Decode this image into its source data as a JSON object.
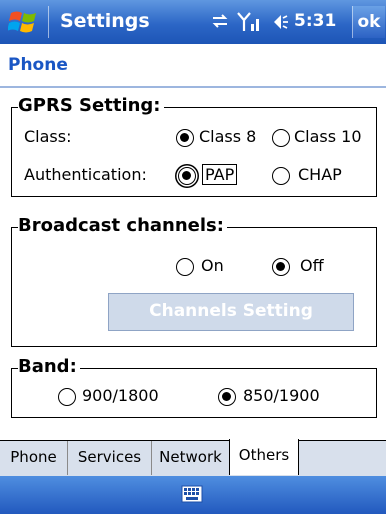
{
  "titlebar": {
    "title": "Settings",
    "time": "5:31",
    "ok_label": "ok",
    "icons": [
      "windows-start-icon",
      "connectivity-icon",
      "signal-icon",
      "volume-icon"
    ]
  },
  "page": {
    "title": "Phone"
  },
  "gprs": {
    "title": "GPRS Setting:",
    "class_label": "Class:",
    "class_options": [
      "Class 8",
      "Class 10"
    ],
    "class_selected": "Class 8",
    "auth_label": "Authentication:",
    "auth_options": [
      "PAP",
      "CHAP"
    ],
    "auth_selected": "PAP"
  },
  "broadcast": {
    "title": "Broadcast channels:",
    "options": [
      "On",
      "Off"
    ],
    "selected": "Off",
    "channels_button": "Channels Setting"
  },
  "band": {
    "title": "Band:",
    "options": [
      "900/1800",
      "850/1900"
    ],
    "selected": "850/1900"
  },
  "tabs": [
    {
      "label": "Phone"
    },
    {
      "label": "Services"
    },
    {
      "label": "Network"
    },
    {
      "label": "Others"
    }
  ],
  "active_tab": "Others",
  "bottom": {
    "icons": [
      "keyboard-icon"
    ]
  },
  "colors": {
    "title_blue": "#1a56c4",
    "bar_blue": "#2c66c6"
  }
}
